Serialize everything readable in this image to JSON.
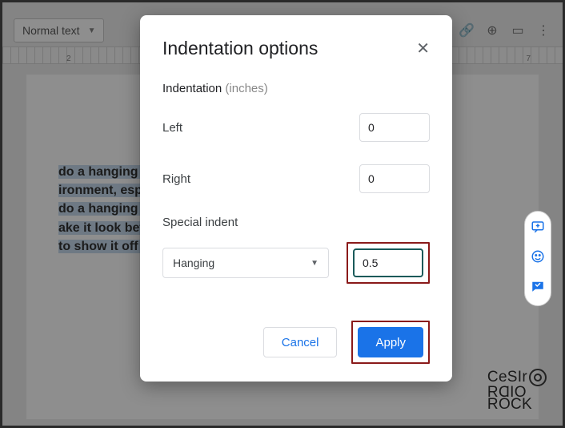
{
  "toolbar": {
    "style_dropdown": "Normal text",
    "ruler_marks": [
      "2",
      "7"
    ]
  },
  "document": {
    "visible_text": "do a hanging indent\nironment, especially\ndo a hanging inden\nake it look better. Ba\nto show it off proper"
  },
  "dialog": {
    "title": "Indentation options",
    "section": "Indentation",
    "unit": "(inches)",
    "left_label": "Left",
    "left_value": "0",
    "right_label": "Right",
    "right_value": "0",
    "special_label": "Special indent",
    "special_type": "Hanging",
    "special_value": "0.5",
    "cancel": "Cancel",
    "apply": "Apply"
  },
  "watermark": {
    "line1": "CeSIr",
    "line2": "RⱭIO",
    "line3": "ROCK"
  }
}
